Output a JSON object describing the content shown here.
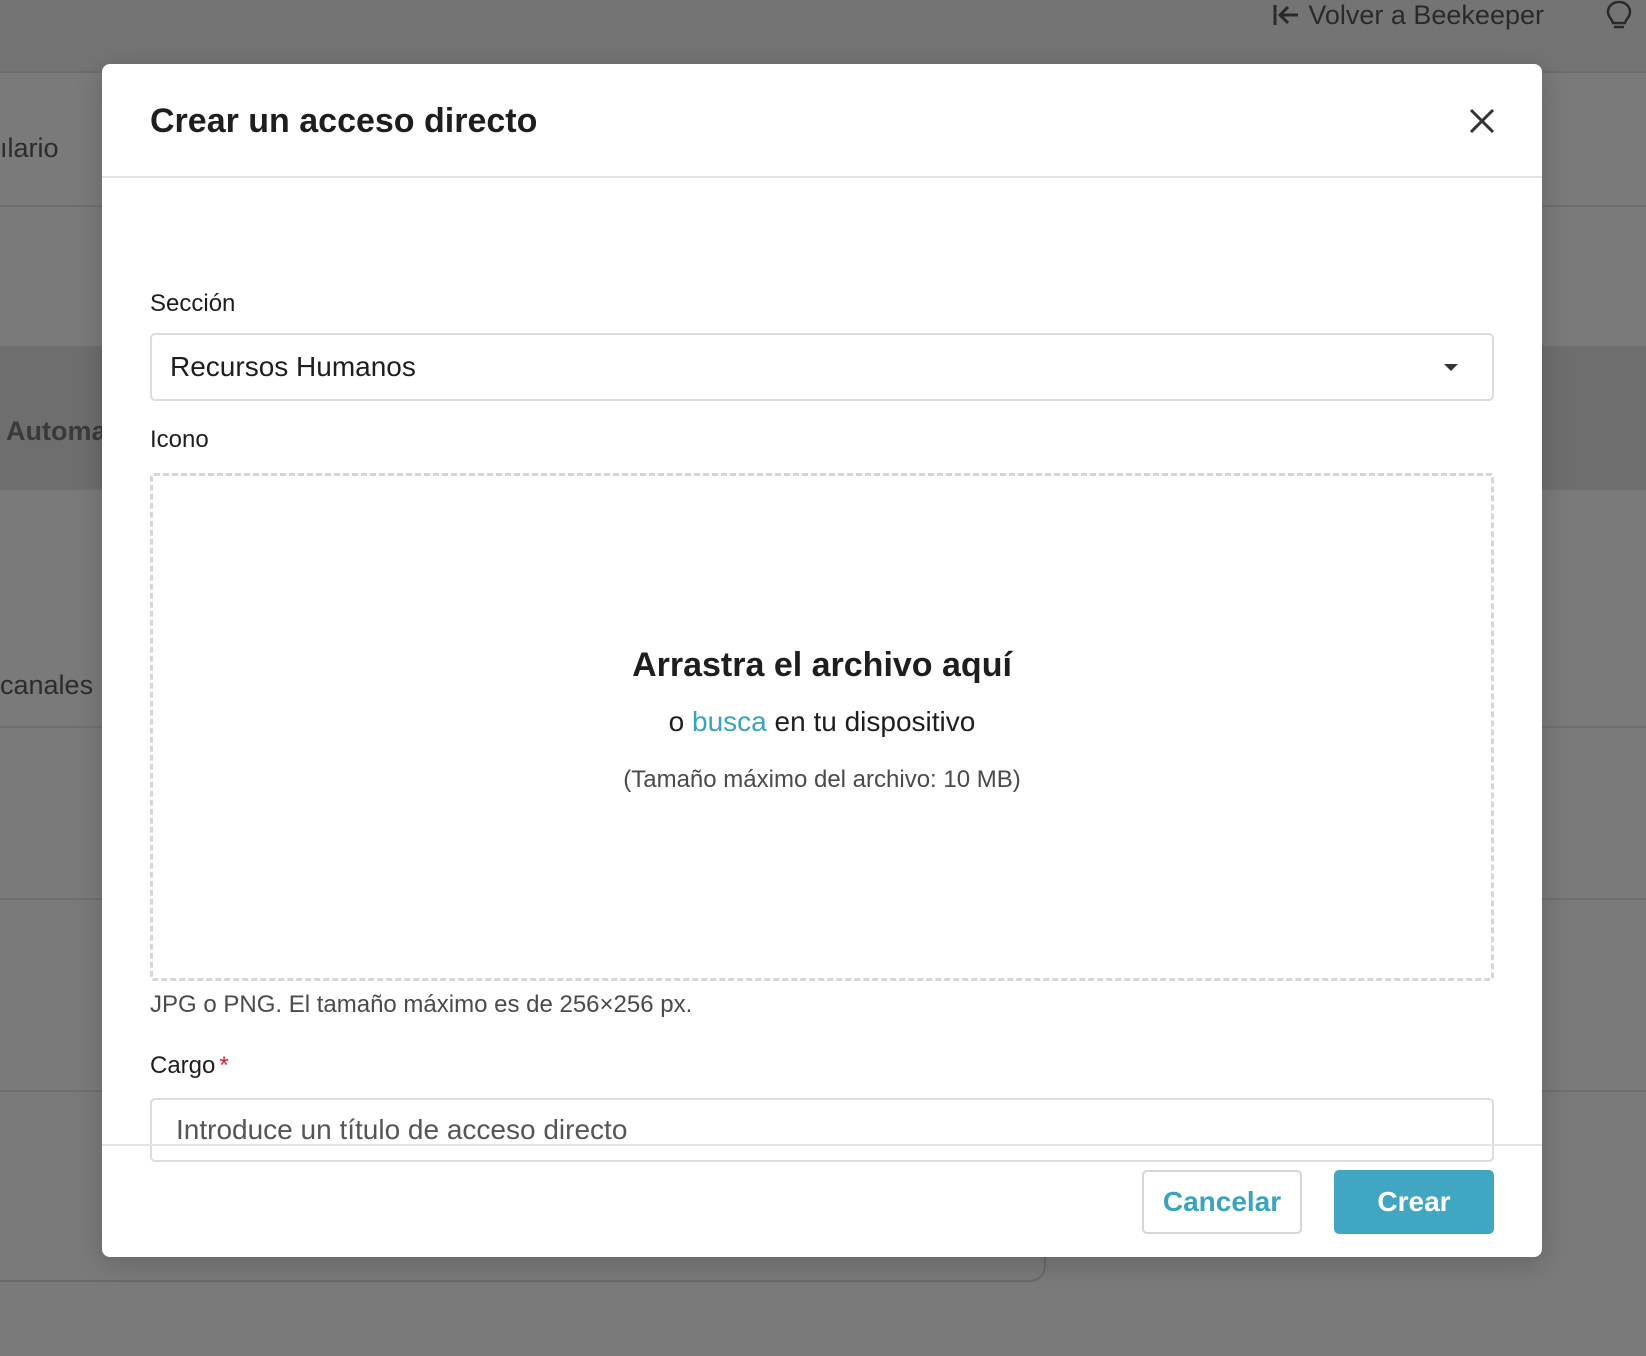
{
  "background": {
    "back_link_label": "Volver a Beekeeper",
    "partial_texts": [
      "ılario",
      "Automa",
      "canales p"
    ]
  },
  "modal": {
    "title": "Crear un acceso directo",
    "close_icon": "close-icon",
    "section": {
      "label": "Sección",
      "selected_value": "Recursos Humanos"
    },
    "icon_field": {
      "label": "Icono",
      "drop_title": "Arrastra el archivo aquí",
      "drop_prefix": "o",
      "drop_link": "busca",
      "drop_suffix": "en tu dispositivo",
      "max_size_note": "(Tamaño máximo del archivo: 10 MB)",
      "help_text": "JPG o PNG. El tamaño máximo es de 256×256 px."
    },
    "cargo": {
      "label": "Cargo",
      "required_mark": "*",
      "value": "",
      "placeholder": "Introduce un título de acceso directo"
    },
    "footer": {
      "cancel_label": "Cancelar",
      "create_label": "Crear"
    }
  },
  "colors": {
    "accent": "#41a6c2",
    "link": "#3aa3bd",
    "required": "#c8202f",
    "overlay": "#7a7a7a"
  }
}
